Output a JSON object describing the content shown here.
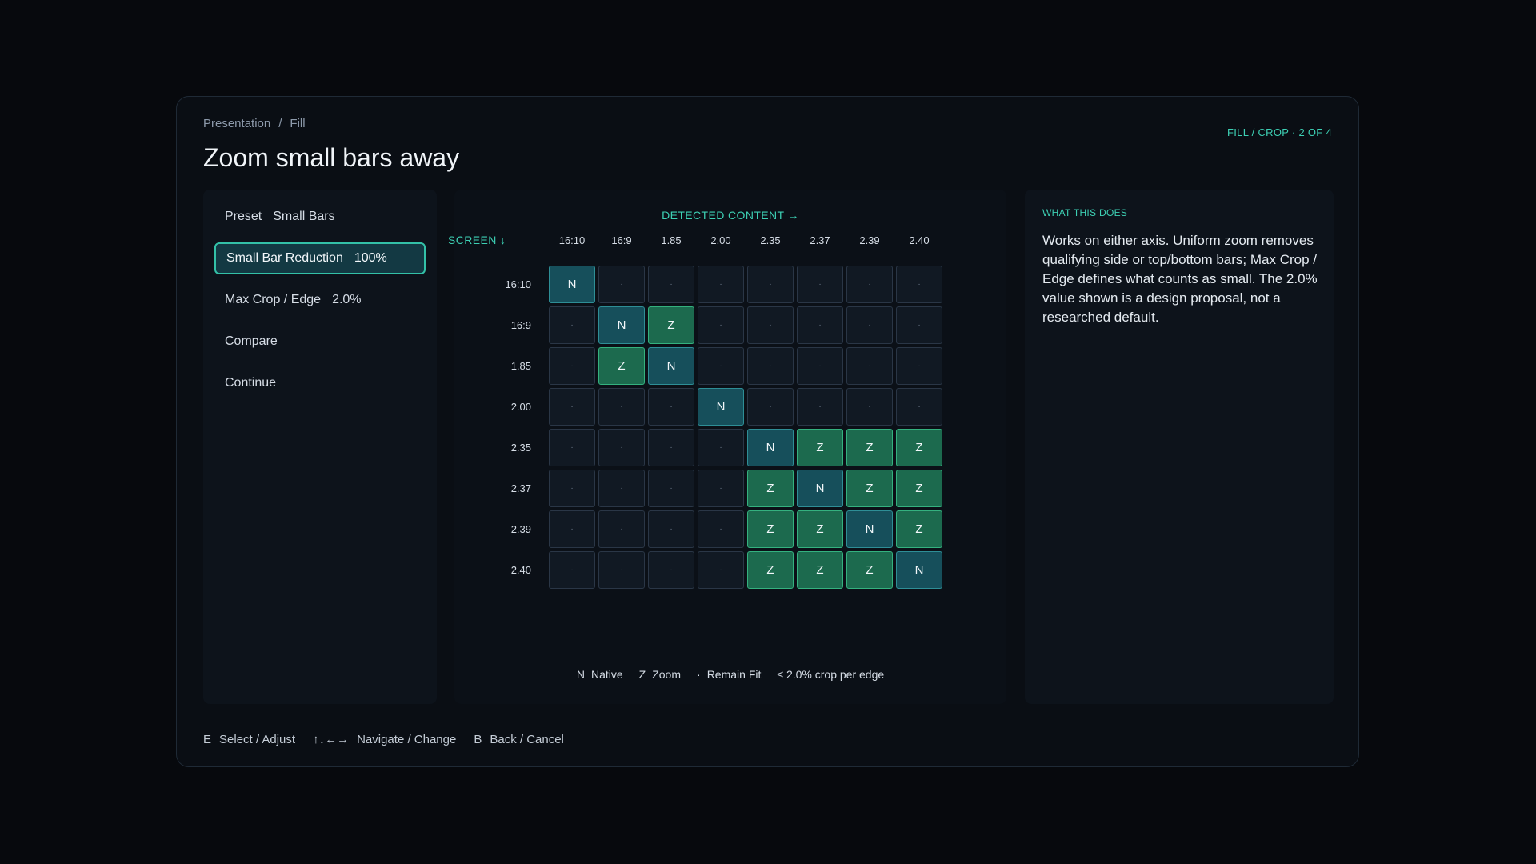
{
  "breadcrumb": {
    "parent": "Presentation",
    "separator": "/",
    "current": "Fill"
  },
  "page": {
    "title": "Zoom small bars away",
    "step": "FILL / CROP · 2 OF 4"
  },
  "menu": {
    "items": [
      {
        "label": "Preset",
        "value": "Small Bars",
        "active": false
      },
      {
        "label": "Small Bar Reduction",
        "value": "100%",
        "active": true
      },
      {
        "label": "Max Crop / Edge",
        "value": "2.0%",
        "active": false
      },
      {
        "label": "Compare",
        "value": "",
        "active": false
      },
      {
        "label": "Continue",
        "value": "",
        "active": false
      }
    ]
  },
  "matrix": {
    "columns_title": "DETECTED CONTENT →",
    "rows_title": "SCREEN ↓",
    "columns": [
      "16:10",
      "16:9",
      "1.85",
      "2.00",
      "2.35",
      "2.37",
      "2.39",
      "2.40"
    ],
    "rows": [
      "16:10",
      "16:9",
      "1.85",
      "2.00",
      "2.35",
      "2.37",
      "2.39",
      "2.40"
    ],
    "cells": [
      [
        "N",
        "·",
        "·",
        "·",
        "·",
        "·",
        "·",
        "·"
      ],
      [
        "·",
        "N",
        "Z",
        "·",
        "·",
        "·",
        "·",
        "·"
      ],
      [
        "·",
        "Z",
        "N",
        "·",
        "·",
        "·",
        "·",
        "·"
      ],
      [
        "·",
        "·",
        "·",
        "N",
        "·",
        "·",
        "·",
        "·"
      ],
      [
        "·",
        "·",
        "·",
        "·",
        "N",
        "Z",
        "Z",
        "Z"
      ],
      [
        "·",
        "·",
        "·",
        "·",
        "Z",
        "N",
        "Z",
        "Z"
      ],
      [
        "·",
        "·",
        "·",
        "·",
        "Z",
        "Z",
        "N",
        "Z"
      ],
      [
        "·",
        "·",
        "·",
        "·",
        "Z",
        "Z",
        "Z",
        "N"
      ]
    ],
    "legend": [
      {
        "key": "N",
        "label": "Native"
      },
      {
        "key": "Z",
        "label": "Zoom"
      },
      {
        "key": "·",
        "label": "Remain Fit"
      },
      {
        "key": "",
        "label": "≤ 2.0% crop per edge"
      }
    ]
  },
  "info": {
    "heading": "WHAT THIS DOES",
    "body": "Works on either axis. Uniform zoom removes qualifying side or top/bottom bars; Max Crop / Edge defines what counts as small. The 2.0% value shown is a design proposal, not a researched default."
  },
  "hints": [
    {
      "key": "E",
      "label": "Select / Adjust"
    },
    {
      "key": "↑↓←→",
      "label": "Navigate / Change"
    },
    {
      "key": "B",
      "label": "Back / Cancel"
    }
  ],
  "colors": {
    "accent": "#3dd0b4",
    "native": "#164f5b",
    "zoom": "#1c6a4e"
  }
}
